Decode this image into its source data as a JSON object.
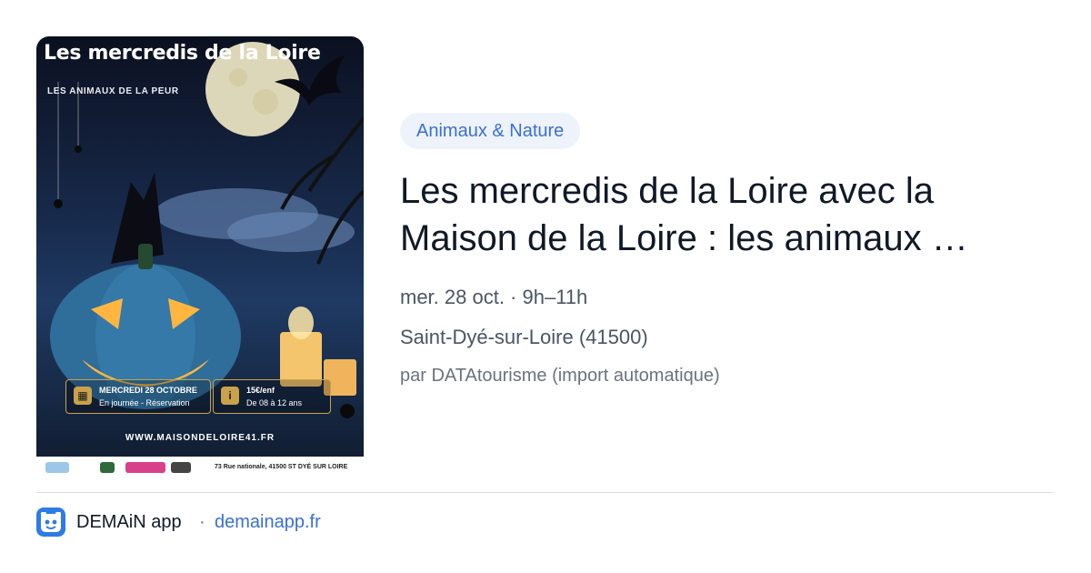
{
  "poster": {
    "title": "Les mercredis de la Loire",
    "subtitle": "LES ANIMAUX DE LA PEUR",
    "date_line1": "MERCREDI 28 OCTOBRE",
    "date_line2": "En journée - Réservation",
    "price_line1": "15€/enf",
    "price_line2": "De 08 à 12 ans",
    "url": "WWW.MAISONDELOIRE41.FR",
    "address": "73 Rue nationale, 41500 ST DYÉ SUR LOIRE"
  },
  "card": {
    "category": "Animaux & Nature",
    "title_line1": "Les mercredis de la Loire avec la",
    "title_line2": "Maison de la Loire : les animaux …",
    "date_time": "mer. 28 oct. · 9h–11h",
    "location": "Saint-Dyé-sur-Loire (41500)",
    "source": "par DATAtourisme (import automatique)"
  },
  "footer": {
    "app_name": "DEMAiN app",
    "separator": "·",
    "link": "demainapp.fr"
  },
  "colors": {
    "accent": "#3a6fd8",
    "pill_bg": "#eef3fb",
    "app_icon": "#2d7be5"
  },
  "icons": {
    "app": "demain-app-icon",
    "calendar": "calendar-icon",
    "info": "info-icon"
  }
}
